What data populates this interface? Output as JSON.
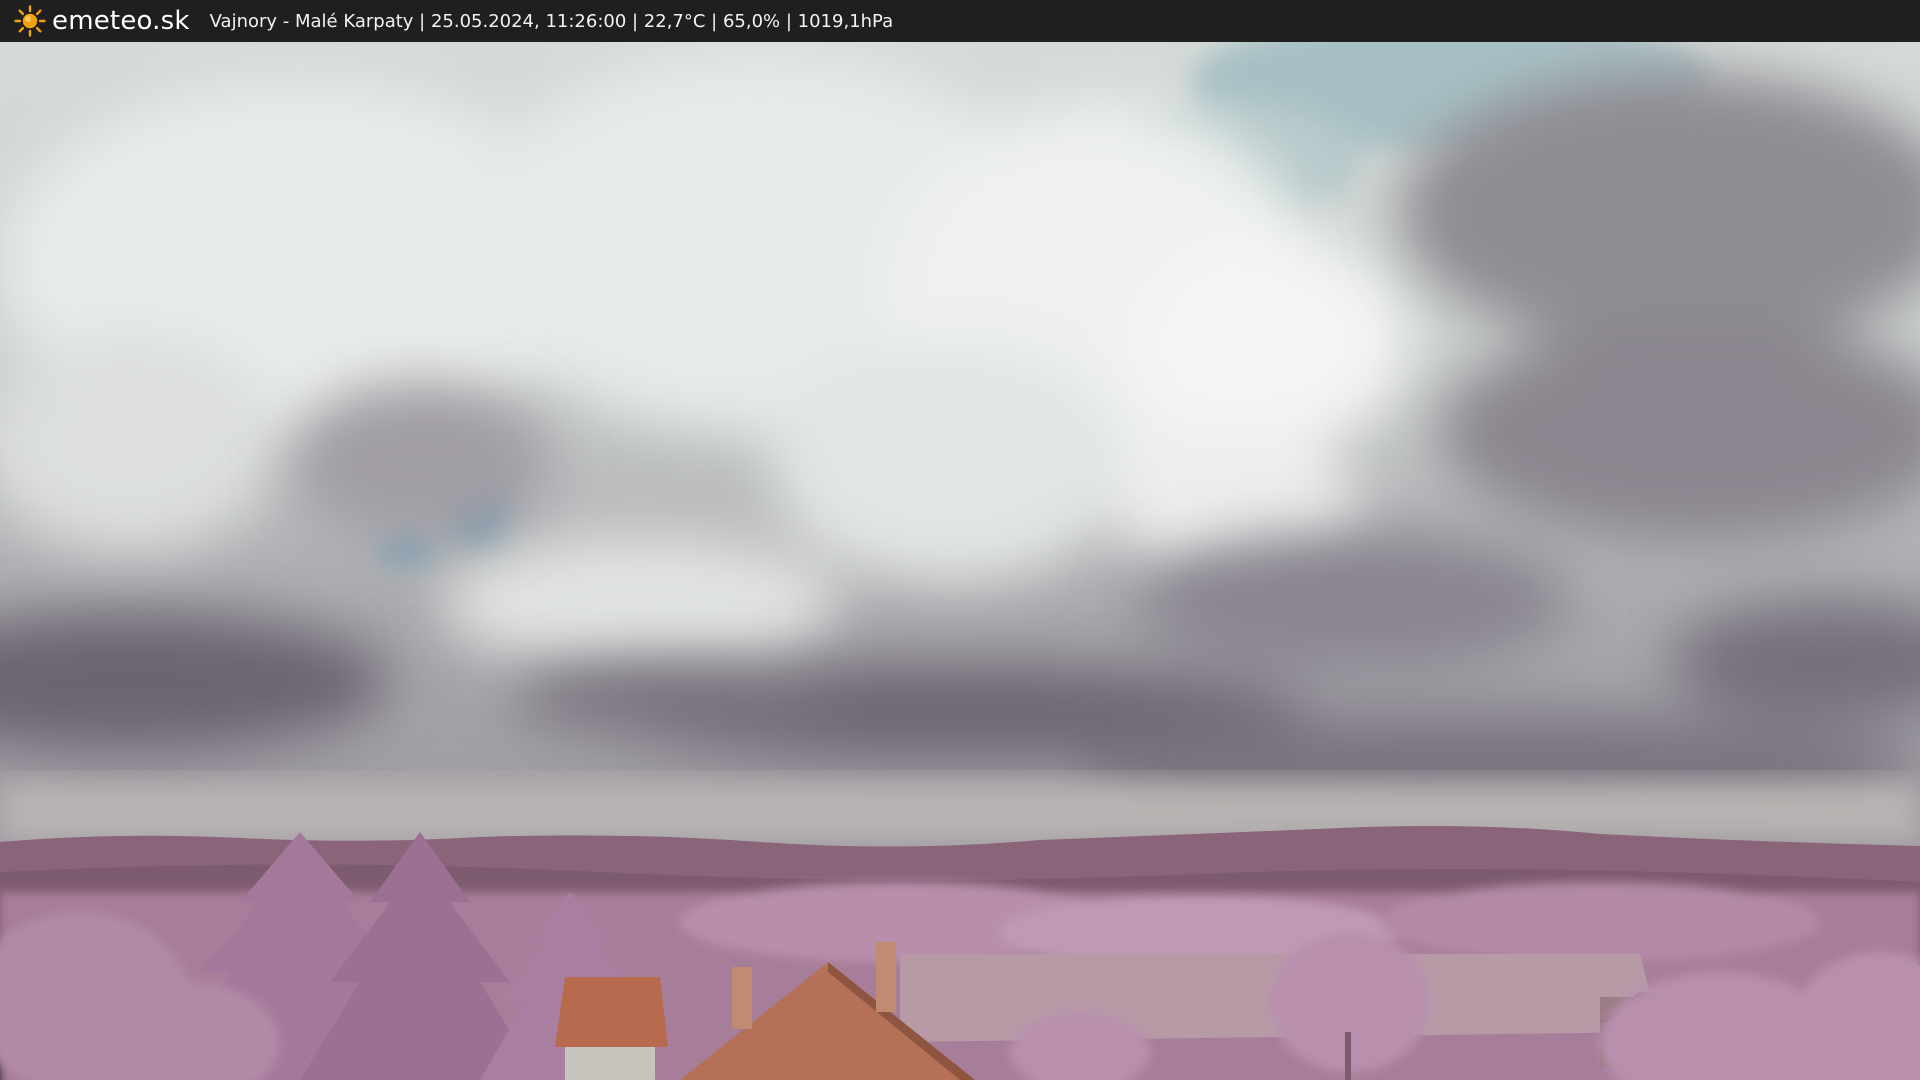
{
  "header": {
    "logo_icon": "sun-icon",
    "brand": "emeteo.sk",
    "caption": "Vajnory - Malé Karpaty | 25.05.2024, 11:26:00 | 22,7°C | 65,0% | 1019,1hPa"
  },
  "colors": {
    "bar_background": "#1f1f1f",
    "sun": "#f2a40f",
    "sky_light": "#e4e9e6",
    "cloud_dark": "#6f6873",
    "hills": "#8a6478",
    "foliage": "#b58aa8",
    "roof": "#b86a4e"
  }
}
